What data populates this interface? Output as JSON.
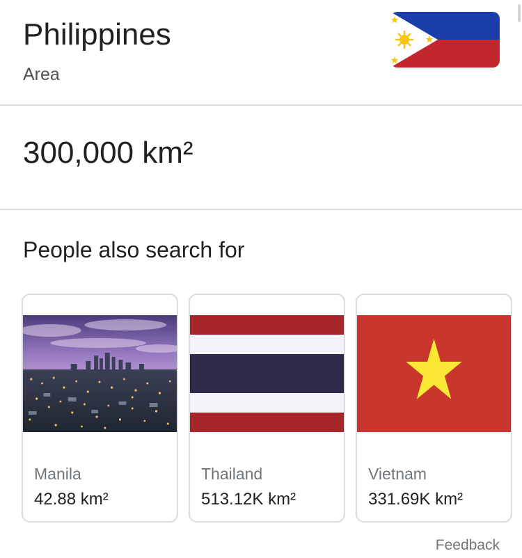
{
  "header": {
    "title": "Philippines",
    "subtitle": "Area",
    "flag_icon": "philippines-flag-icon"
  },
  "result": {
    "value": "300,000 km²"
  },
  "related": {
    "heading": "People also search for",
    "items": [
      {
        "name": "Manila",
        "value": "42.88 km²",
        "image": "manila-skyline-photo"
      },
      {
        "name": "Thailand",
        "value": "513.12K km²",
        "image": "thailand-flag-icon"
      },
      {
        "name": "Vietnam",
        "value": "331.69K km²",
        "image": "vietnam-flag-icon"
      }
    ]
  },
  "footer": {
    "feedback": "Feedback"
  },
  "colors": {
    "ph_blue": "#1a3fa8",
    "ph_red": "#c1272d",
    "ph_sun": "#f5c518",
    "th_red": "#a6262c",
    "th_blue": "#2d2a4a",
    "vn_red": "#c9372c",
    "vn_star": "#fbe834"
  }
}
